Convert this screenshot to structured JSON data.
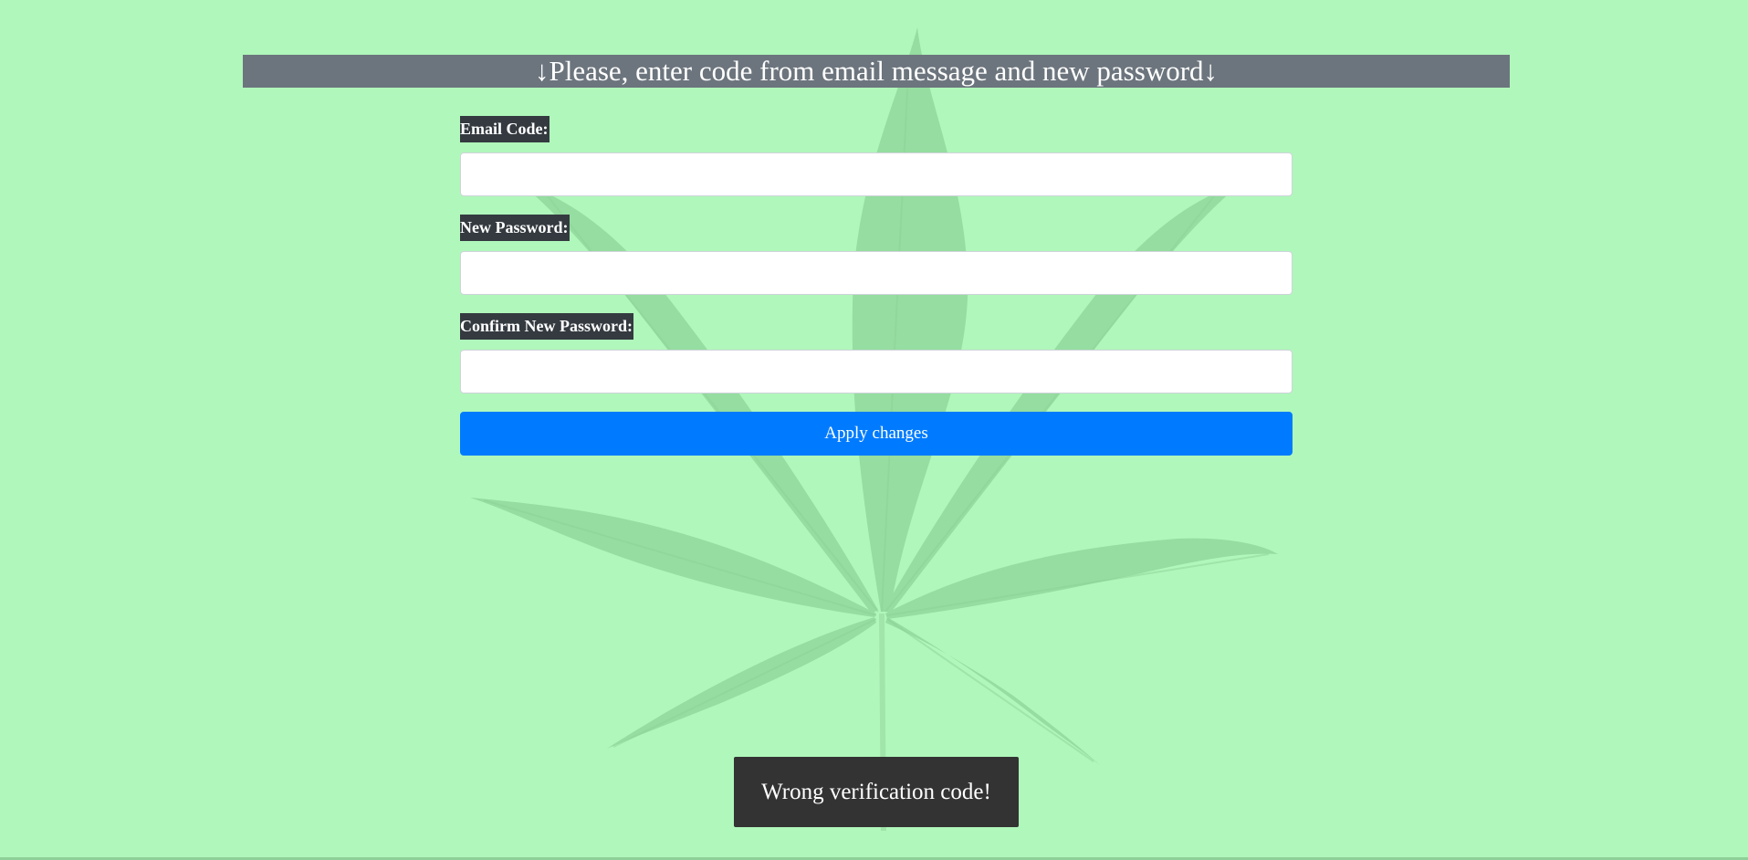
{
  "banner": {
    "text": "↓Please, enter code from email message and new password↓"
  },
  "form": {
    "email_code_label": "Email Code:",
    "email_code_value": "",
    "new_password_label": "New Password:",
    "new_password_value": "",
    "confirm_password_label": "Confirm New Password:",
    "confirm_password_value": "",
    "apply_label": "Apply changes"
  },
  "toast": {
    "message": "Wrong verification code!"
  },
  "background": {
    "icon": "cannabis-leaf-icon"
  },
  "colors": {
    "page_background": "#b0f7bb",
    "banner_background": "#6c757d",
    "label_background": "#343a40",
    "button_primary": "#007bff",
    "toast_background": "#333333"
  }
}
